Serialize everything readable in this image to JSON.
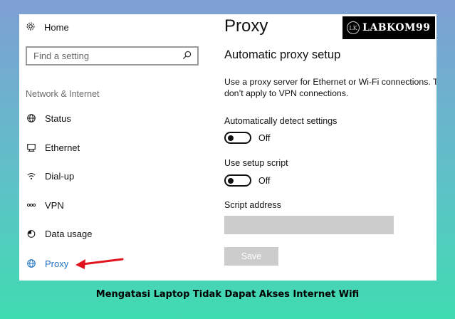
{
  "sidebar": {
    "home_label": "Home",
    "search_placeholder": "Find a setting",
    "section_label": "Network & Internet",
    "items": [
      {
        "label": "Status",
        "icon": "globe-icon"
      },
      {
        "label": "Ethernet",
        "icon": "ethernet-icon"
      },
      {
        "label": "Dial-up",
        "icon": "dial-up-icon"
      },
      {
        "label": "VPN",
        "icon": "vpn-icon"
      },
      {
        "label": "Data usage",
        "icon": "data-usage-icon"
      },
      {
        "label": "Proxy",
        "icon": "globe-icon",
        "active": true
      }
    ],
    "active_color": "#1b6fc2"
  },
  "main": {
    "title": "Proxy",
    "subheading": "Automatic proxy setup",
    "description_line1": "Use a proxy server for Ethernet or Wi-Fi connections. T",
    "description_line2": "don’t apply to VPN connections.",
    "auto_detect_label": "Automatically detect settings",
    "auto_detect_state": "Off",
    "setup_script_label": "Use setup script",
    "setup_script_state": "Off",
    "script_address_label": "Script address",
    "script_address_value": "",
    "save_label": "Save"
  },
  "watermark": {
    "logo_text": "LK",
    "text": "LABKOM99"
  },
  "caption": "Mengatasi Laptop Tidak Dapat Akses Internet Wifi",
  "colors": {
    "background_top": "#7f9fd4",
    "background_bottom": "#3fdcb0",
    "arrow": "#e0141e",
    "disabled_gray": "#cccccc"
  }
}
